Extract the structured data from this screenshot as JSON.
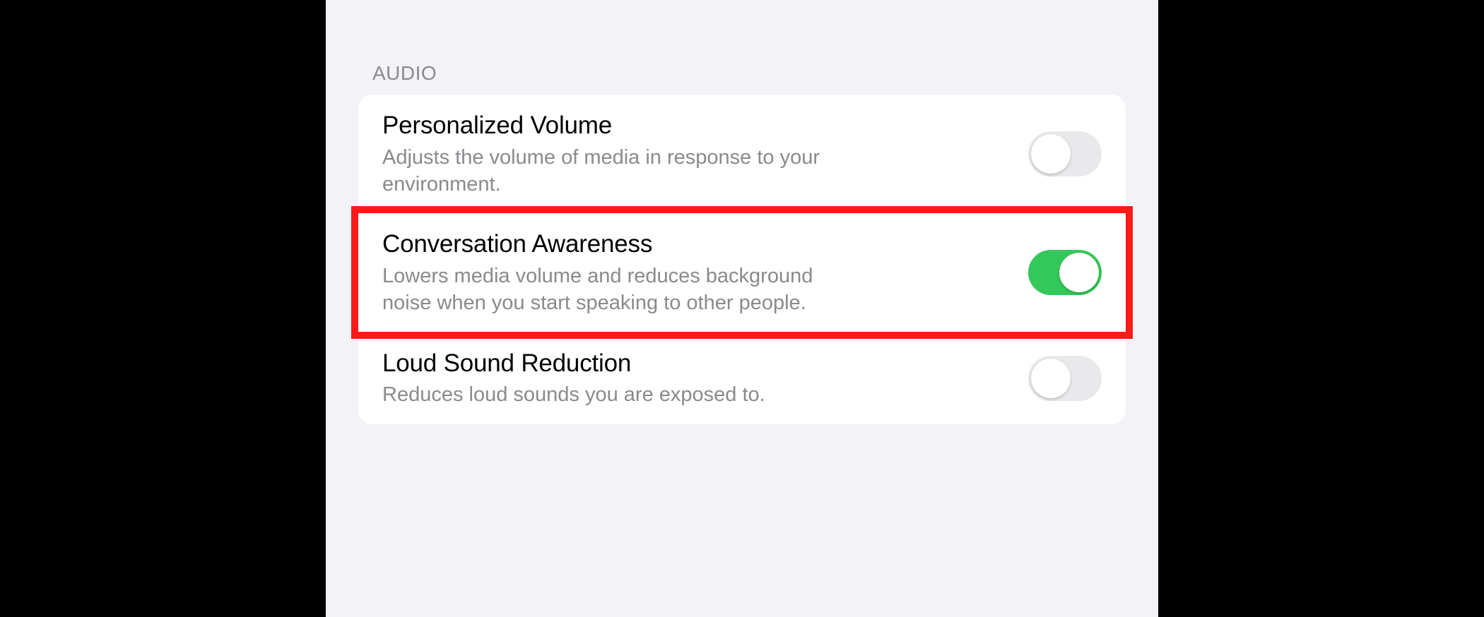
{
  "section_header": "AUDIO",
  "rows": {
    "personalized_volume": {
      "title": "Personalized Volume",
      "subtitle": "Adjusts the volume of media in response to your environment.",
      "on": false
    },
    "conversation_awareness": {
      "title": "Conversation Awareness",
      "subtitle": "Lowers media volume and reduces background noise when you start speaking to other people.",
      "on": true,
      "highlighted": true
    },
    "loud_sound_reduction": {
      "title": "Loud Sound Reduction",
      "subtitle": "Reduces loud sounds you are exposed to.",
      "on": false
    }
  }
}
